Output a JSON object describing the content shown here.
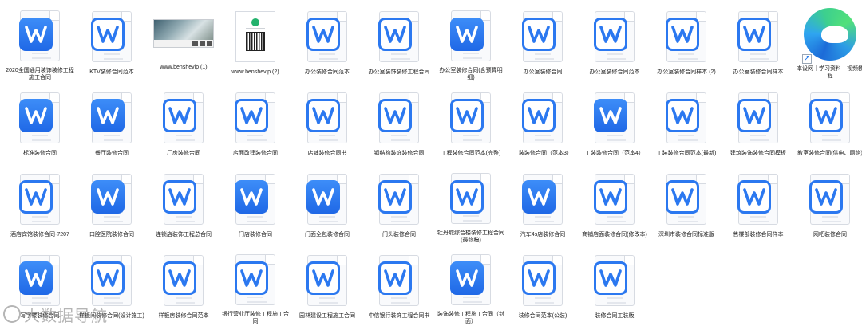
{
  "colors": {
    "accent": "#2b78f0",
    "page_border": "#d7dbe2",
    "background": "#ffffff"
  },
  "files": [
    {
      "row": 0,
      "col": 0,
      "type": "doc",
      "style": "solid",
      "name": "2020全国通用装饰装修工程施工合同"
    },
    {
      "row": 0,
      "col": 1,
      "type": "doc",
      "style": "outline",
      "name": "KTV装修合同范本"
    },
    {
      "row": 0,
      "col": 2,
      "type": "image-photo",
      "name": "www.benshevip (1)"
    },
    {
      "row": 0,
      "col": 3,
      "type": "image-qr",
      "name": "www.benshevip (2)"
    },
    {
      "row": 0,
      "col": 4,
      "type": "doc",
      "style": "outline",
      "name": "办公装修合同范本"
    },
    {
      "row": 0,
      "col": 5,
      "type": "doc",
      "style": "outline",
      "name": "办公室装饰装修工程合同"
    },
    {
      "row": 0,
      "col": 6,
      "type": "doc",
      "style": "solid",
      "name": "办公室装修合同(含预算明细)"
    },
    {
      "row": 0,
      "col": 7,
      "type": "doc",
      "style": "outline",
      "name": "办公室装修合同"
    },
    {
      "row": 0,
      "col": 8,
      "type": "doc",
      "style": "outline",
      "name": "办公室装修合同范本"
    },
    {
      "row": 0,
      "col": 9,
      "type": "doc",
      "style": "outline",
      "name": "办公室装修合同样本 (2)"
    },
    {
      "row": 0,
      "col": 10,
      "type": "doc",
      "style": "outline",
      "name": "办公室装修合同样本"
    },
    {
      "row": 0,
      "col": 11,
      "type": "shortcut-edge",
      "name": "本设网｜学习资料｜视频教程"
    },
    {
      "row": 1,
      "col": 0,
      "type": "doc",
      "style": "solid",
      "name": "标准装修合同"
    },
    {
      "row": 1,
      "col": 1,
      "type": "doc",
      "style": "solid",
      "name": "餐厅装修合同"
    },
    {
      "row": 1,
      "col": 2,
      "type": "doc",
      "style": "outline",
      "name": "厂房装修合同"
    },
    {
      "row": 1,
      "col": 3,
      "type": "doc",
      "style": "outline",
      "name": "店面改建装修合同"
    },
    {
      "row": 1,
      "col": 4,
      "type": "doc",
      "style": "outline",
      "name": "店铺装修合同书"
    },
    {
      "row": 1,
      "col": 5,
      "type": "doc",
      "style": "outline",
      "name": "钢结构装饰装修合同"
    },
    {
      "row": 1,
      "col": 6,
      "type": "doc",
      "style": "outline",
      "name": "工程装修合同范本(完整)"
    },
    {
      "row": 1,
      "col": 7,
      "type": "doc",
      "style": "outline",
      "name": "工装装修合同（范本3）"
    },
    {
      "row": 1,
      "col": 8,
      "type": "doc",
      "style": "solid",
      "name": "工装装修合同（范本4）"
    },
    {
      "row": 1,
      "col": 9,
      "type": "doc",
      "style": "outline",
      "name": "工装装修合同范本(最新)"
    },
    {
      "row": 1,
      "col": 10,
      "type": "doc",
      "style": "outline",
      "name": "建筑装饰装修合同模板"
    },
    {
      "row": 1,
      "col": 11,
      "type": "doc",
      "style": "outline",
      "name": "教室装修合同(供电、网络)"
    },
    {
      "row": 2,
      "col": 0,
      "type": "doc",
      "style": "outline",
      "name": "酒店宾馆装修合同-7207"
    },
    {
      "row": 2,
      "col": 1,
      "type": "doc",
      "style": "solid",
      "name": "口腔医院装修合同"
    },
    {
      "row": 2,
      "col": 2,
      "type": "doc",
      "style": "outline",
      "name": "连锁店装饰工程总合同"
    },
    {
      "row": 2,
      "col": 3,
      "type": "doc",
      "style": "solid",
      "name": "门店装修合同"
    },
    {
      "row": 2,
      "col": 4,
      "type": "doc",
      "style": "solid",
      "name": "门面全包装修合同"
    },
    {
      "row": 2,
      "col": 5,
      "type": "doc",
      "style": "outline",
      "name": "门头装修合同"
    },
    {
      "row": 2,
      "col": 6,
      "type": "doc",
      "style": "outline",
      "name": "牡丹城综合楼装修工程合同(最终稿)"
    },
    {
      "row": 2,
      "col": 7,
      "type": "doc",
      "style": "solid",
      "name": "汽车4s店装修合同"
    },
    {
      "row": 2,
      "col": 8,
      "type": "doc",
      "style": "outline",
      "name": "商铺店面装修合同(修改本)"
    },
    {
      "row": 2,
      "col": 9,
      "type": "doc",
      "style": "outline",
      "name": "深圳市装修合同标准版"
    },
    {
      "row": 2,
      "col": 10,
      "type": "doc",
      "style": "outline",
      "name": "售楼部装修合同样本"
    },
    {
      "row": 2,
      "col": 11,
      "type": "doc",
      "style": "outline",
      "name": "网吧装修合同"
    },
    {
      "row": 3,
      "col": 0,
      "type": "doc",
      "style": "solid",
      "name": "写字楼装修合同"
    },
    {
      "row": 3,
      "col": 1,
      "type": "doc",
      "style": "outline",
      "name": "样板间装修合同(设计施工)"
    },
    {
      "row": 3,
      "col": 2,
      "type": "doc",
      "style": "outline",
      "name": "样板房装修合同范本"
    },
    {
      "row": 3,
      "col": 3,
      "type": "doc",
      "style": "outline",
      "name": "银行营业厅装修工程施工合同"
    },
    {
      "row": 3,
      "col": 4,
      "type": "doc",
      "style": "outline",
      "name": "园林建设工程施工合同"
    },
    {
      "row": 3,
      "col": 5,
      "type": "doc",
      "style": "outline",
      "name": "中信银行装饰工程合同书"
    },
    {
      "row": 3,
      "col": 6,
      "type": "doc",
      "style": "solid",
      "name": "装饰装修工程施工合同（封面）"
    },
    {
      "row": 3,
      "col": 7,
      "type": "doc",
      "style": "outline",
      "name": "装修合同范本(公装)"
    },
    {
      "row": 3,
      "col": 8,
      "type": "doc",
      "style": "outline",
      "name": "装修合同工装版"
    }
  ],
  "watermark": {
    "text": "大数据导航"
  }
}
